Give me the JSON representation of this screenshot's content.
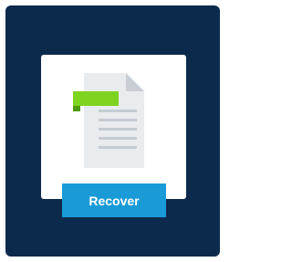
{
  "recover_button": {
    "label": "Recover"
  },
  "icons": {
    "document": "document-with-tag-icon"
  },
  "colors": {
    "frame_background": "#0c2a4c",
    "card_background": "#ffffff",
    "button_background": "#1a9ad6",
    "button_text": "#ffffff",
    "tag_accent": "#7ed321",
    "document_fill": "#e9ecef",
    "document_fold": "#c8ced4"
  }
}
